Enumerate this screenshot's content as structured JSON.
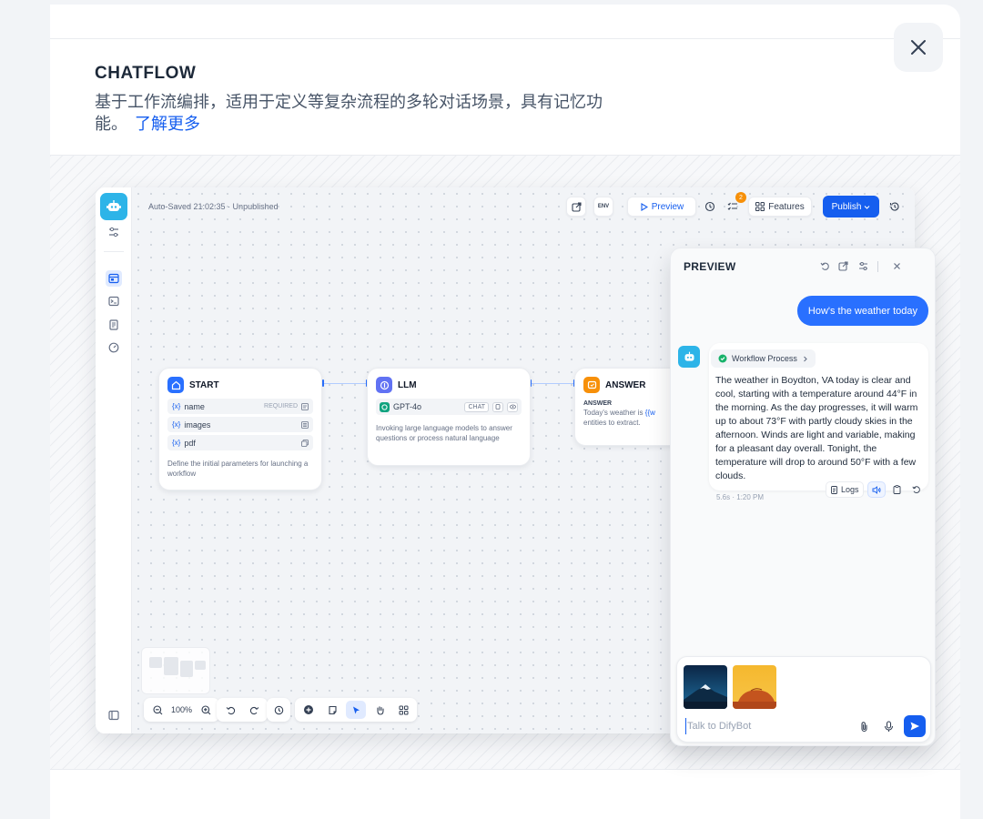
{
  "header": {
    "title": "CHATFLOW",
    "description": "基于工作流编排，适用于定义等复杂流程的多轮对话场景，具有记忆功能。",
    "learn_more": "了解更多"
  },
  "topbar": {
    "status": "Auto-Saved 21:02:35 · Unpublished",
    "env_label": "ENV",
    "preview_label": "Preview",
    "checklist_count": "2",
    "features_label": "Features",
    "publish_label": "Publish"
  },
  "nodes": {
    "start": {
      "title": "START",
      "variables": [
        {
          "name": "name",
          "tag": "REQUIRED"
        },
        {
          "name": "images",
          "tag": ""
        },
        {
          "name": "pdf",
          "tag": ""
        }
      ],
      "var_prefix": "{x}",
      "description": "Define the initial parameters for launching a workflow"
    },
    "llm": {
      "title": "LLM",
      "model": "GPT-4o",
      "mode": "CHAT",
      "description": "Invoking large language models to answer questions or process natural language"
    },
    "answer": {
      "title": "ANSWER",
      "label": "ANSWER",
      "text_prefix": "Today's weather is ",
      "text_var": "{{w",
      "text_suffix": "entities to extract."
    }
  },
  "toolbar": {
    "zoom": "100%"
  },
  "preview": {
    "title": "PREVIEW",
    "user_message": "How's the weather today",
    "workflow_label": "Workflow Process",
    "bot_message": "The weather in Boydton, VA today is clear and cool, starting with a temperature around 44°F in the morning. As the day progresses, it will warm up to about 73°F with partly cloudy skies in the afternoon. Winds are light and variable, making for a pleasant day overall. Tonight, the temperature will drop to around 50°F with a few clouds.",
    "logs_label": "Logs",
    "meta": "5.6s · 1:20 PM",
    "input_placeholder": "Talk to DifyBot"
  },
  "colors": {
    "accent": "#155eef",
    "bot_avatar": "#2db4e8",
    "start_node": "#2970ff",
    "llm_node": "#6172f3",
    "answer_node": "#f79009",
    "success": "#17b26a"
  }
}
